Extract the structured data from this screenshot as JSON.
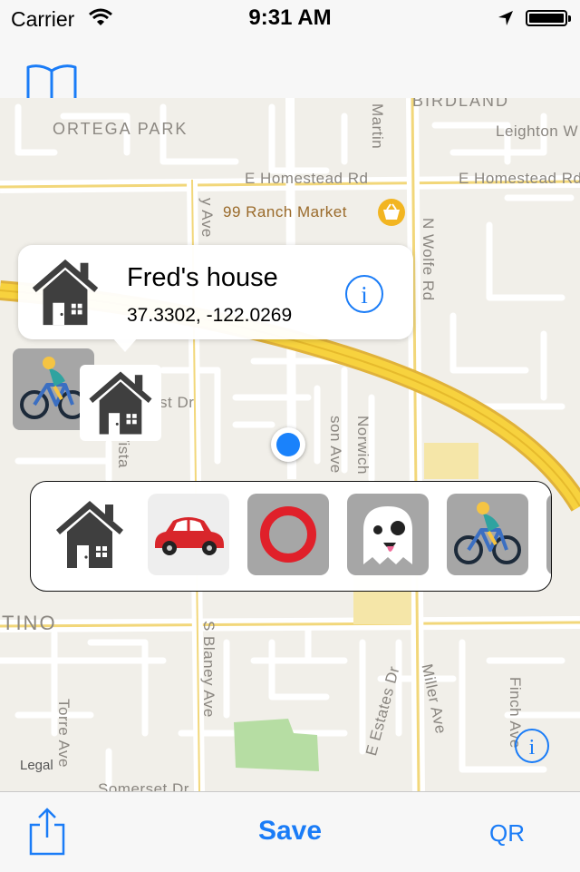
{
  "status_bar": {
    "carrier": "Carrier",
    "time": "9:31 AM",
    "icons": [
      "wifi-icon",
      "location-arrow-icon",
      "battery-icon"
    ]
  },
  "nav_bar": {
    "left_button_icon": "book-icon"
  },
  "map": {
    "labels": {
      "birdland": "BIRDLAND",
      "ortega_park": "ORTEGA PARK",
      "leighton": "Leighton W",
      "homestead_left": "E Homestead Rd",
      "homestead_right": "E Homestead Rd",
      "ranch_market": "99 Ranch Market",
      "martin": "Martin",
      "wolfe": "N Wolfe Rd",
      "blaney_ave_top": "y Ave",
      "vista": "Vista",
      "st_dr": "st Dr",
      "son_ave": "son Ave",
      "norwich": "Norwich",
      "tino": "TINO",
      "s_blaney": "S Blaney Ave",
      "torre": "Torre Ave",
      "e_estates": "E Estates Dr",
      "miller": "Miller Ave",
      "finch": "Finch Ave",
      "somerset": "Somerset Dr"
    },
    "legal": "Legal",
    "info_icon": "info-icon",
    "colors": {
      "background": "#f1efe9",
      "highway": "#f7d23e",
      "park": "#b6dda3",
      "user_location": "#1a82fb"
    }
  },
  "callout": {
    "title": "Fred's house",
    "coordinates": "37.3302, -122.0269",
    "icon": "house-icon",
    "info_icon": "info-icon"
  },
  "pins": [
    "bicycle-icon",
    "house-icon"
  ],
  "icon_picker": {
    "tiles": [
      "house-icon",
      "car-icon",
      "red-ring-icon",
      "ghost-icon",
      "bicycle-icon"
    ]
  },
  "toolbar": {
    "share_icon": "share-icon",
    "save_label": "Save",
    "qr_label": "QR"
  },
  "colors": {
    "accent": "#1a7cf7"
  }
}
